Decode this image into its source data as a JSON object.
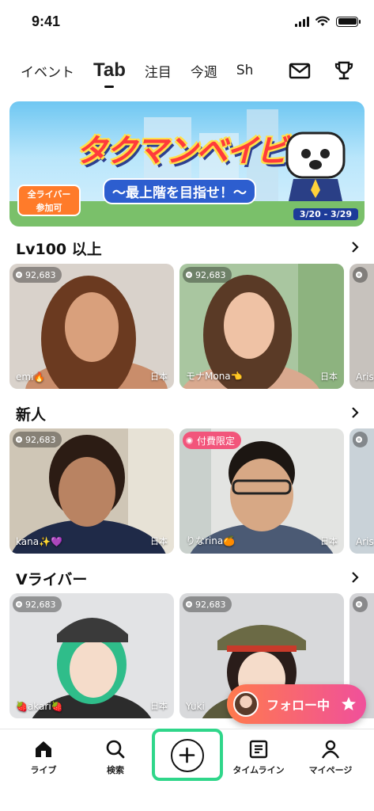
{
  "status_bar": {
    "time": "9:41"
  },
  "tabs": [
    {
      "label": "イベント",
      "active": false
    },
    {
      "label": "Tab",
      "active": true
    },
    {
      "label": "注目",
      "active": false
    },
    {
      "label": "今週",
      "active": false
    },
    {
      "label": "Sh",
      "active": false
    }
  ],
  "header_icons": [
    "mail-icon",
    "trophy-icon"
  ],
  "banner": {
    "title": "タクマンベイビー",
    "subtitle": "〜最上階を目指せ！〜",
    "badge_line1": "全ライバー",
    "badge_line2": "参加可",
    "dates": "3/20 - 3/29"
  },
  "sections": [
    {
      "title": "Lv100 以上",
      "cards": [
        {
          "count": "92,683",
          "name": "emi🔥",
          "country": "日本"
        },
        {
          "count": "92,683",
          "name": "モナMona👈",
          "country": "日本"
        },
        {
          "count": "",
          "name": "Aris",
          "country": ""
        }
      ]
    },
    {
      "title": "新人",
      "cards": [
        {
          "count": "92,683",
          "name": "kana✨💜",
          "country": "日本"
        },
        {
          "badge": "付費限定",
          "name": "りなrina🍊",
          "country": "日本"
        },
        {
          "count": "",
          "name": "Aris",
          "country": ""
        }
      ]
    },
    {
      "title": "Vライバー",
      "cards": [
        {
          "count": "92,683",
          "name": "🍓akari🍓",
          "country": "日本"
        },
        {
          "count": "92,683",
          "name": "Yuki",
          "country": ""
        },
        {
          "count": "",
          "name": "",
          "country": ""
        }
      ]
    }
  ],
  "follow_pill": {
    "label": "フォロー中"
  },
  "bottom_nav": [
    {
      "label": "ライブ",
      "icon": "home-icon"
    },
    {
      "label": "検索",
      "icon": "search-icon"
    },
    {
      "label": "",
      "icon": "plus-icon"
    },
    {
      "label": "タイムライン",
      "icon": "timeline-icon"
    },
    {
      "label": "マイページ",
      "icon": "person-icon"
    }
  ],
  "colors": {
    "accent_green": "#2fd68a",
    "follow_gradient_start": "#ff7a4d",
    "follow_gradient_end": "#f0509b",
    "paid_badge": "#f2557b"
  }
}
